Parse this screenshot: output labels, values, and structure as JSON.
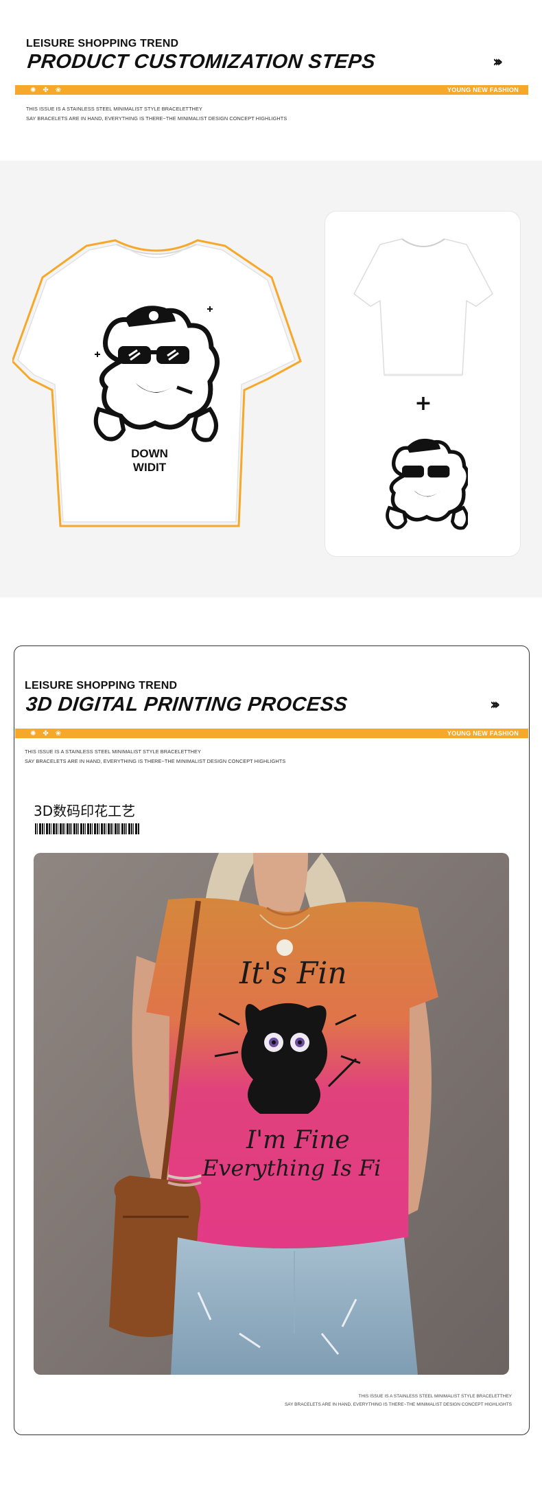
{
  "section1": {
    "kicker": "LEISURE SHOPPING TREND",
    "headline": "PRODUCT CUSTOMIZATION STEPS",
    "arrows": "›››",
    "band_icons": [
      "sun-icon",
      "flower-icon",
      "paw-icon"
    ],
    "band_text": "YOUNG NEW FASHION",
    "line1": "THIS ISSUE IS A STAINLESS STEEL MINIMALIST STYLE BRACELETTHEY",
    "line2": "SAY BRACELETS ARE IN HAND, EVERYTHING IS THERE~THE MINIMALIST DESIGN CONCEPT HIGHLIGHTS"
  },
  "product": {
    "print_text_line1": "DOWN",
    "print_text_line2": "WIDIT",
    "plus": "+",
    "accent": "#f6a82a"
  },
  "section2": {
    "kicker": "LEISURE SHOPPING TREND",
    "headline": "3D DIGITAL PRINTING PROCESS",
    "arrows": "›››",
    "band_icons": [
      "sun-icon",
      "flower-icon",
      "paw-icon"
    ],
    "band_text": "YOUNG NEW FASHION",
    "line1": "THIS ISSUE IS A STAINLESS STEEL MINIMALIST STYLE BRACELETTHEY",
    "line2": "SAY BRACELETS ARE IN HAND, EVERYTHING IS THERE~THE MINIMALIST DESIGN CONCEPT HIGHLIGHTS",
    "cn_title": "3D数码印花工艺",
    "shirt_line1": "It's Fin",
    "shirt_line2": "I'm Fine",
    "shirt_line3": "Everything Is Fi",
    "footer_line1": "THIS ISSUE IS A STAINLESS STEEL MINIMALIST STYLE BRACELETTHEY",
    "footer_line2": "SAY BRACELETS ARE IN HAND, EVERYTHING IS THERE~THE MINIMALIST DESIGN CONCEPT HIGHLIGHTS"
  }
}
